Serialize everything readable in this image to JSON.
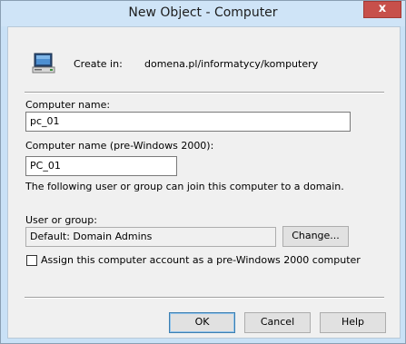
{
  "window": {
    "title": "New Object - Computer",
    "close_glyph": "x"
  },
  "header": {
    "icon": "computer-icon",
    "create_in_label": "Create in:",
    "create_in_path": "domena.pl/informatycy/komputery"
  },
  "form": {
    "computer_name": {
      "label": "Computer name:",
      "value": "pc_01"
    },
    "computer_name_pre2000": {
      "label": "Computer name (pre-Windows 2000):",
      "value": "PC_01"
    },
    "join_info": "The following user or group can join this computer to a domain.",
    "user_or_group": {
      "label": "User or group:",
      "value": "Default: Domain Admins",
      "change_button": "Change..."
    },
    "pre2000_checkbox": {
      "label": "Assign this computer account as a pre-Windows 2000 computer",
      "checked": false
    }
  },
  "footer": {
    "ok": "OK",
    "cancel": "Cancel",
    "help": "Help"
  },
  "colors": {
    "titlebar": "#cfe4f7",
    "close": "#c7504b",
    "dialog_bg": "#f0f0f0",
    "default_button_border": "#3c7fb1"
  }
}
